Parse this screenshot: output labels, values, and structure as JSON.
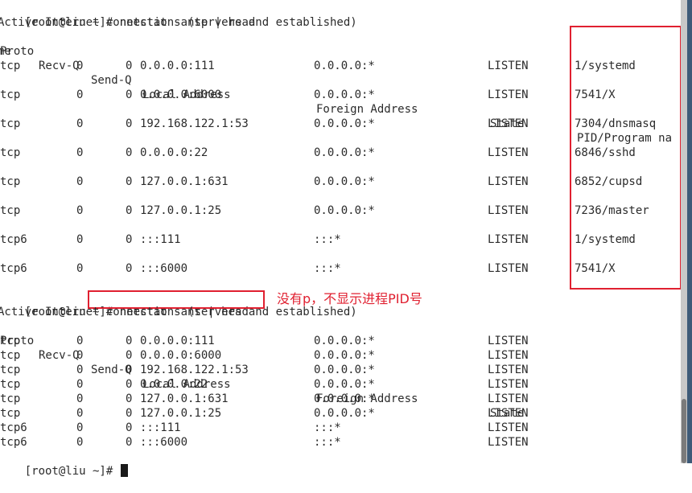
{
  "section1": {
    "prompt": "[root@liu ~]# ",
    "command": "netstat -antp | head",
    "info": "Active Internet connections (servers and established)",
    "headers": {
      "proto": "Proto",
      "recvq": "Recv-Q",
      "sendq": "Send-Q",
      "local": "Local Address",
      "foreign": "Foreign Address",
      "state": "State",
      "pid": "PID/Program na",
      "pid_wrap": "me"
    },
    "rows": [
      {
        "proto": "tcp",
        "recvq": "0",
        "sendq": "0",
        "local": "0.0.0.0:111",
        "foreign": "0.0.0.0:*",
        "state": "LISTEN",
        "pid": "1/systemd"
      },
      {
        "proto": "tcp",
        "recvq": "0",
        "sendq": "0",
        "local": "0.0.0.0:6000",
        "foreign": "0.0.0.0:*",
        "state": "LISTEN",
        "pid": "7541/X"
      },
      {
        "proto": "tcp",
        "recvq": "0",
        "sendq": "0",
        "local": "192.168.122.1:53",
        "foreign": "0.0.0.0:*",
        "state": "LISTEN",
        "pid": "7304/dnsmasq"
      },
      {
        "proto": "tcp",
        "recvq": "0",
        "sendq": "0",
        "local": "0.0.0.0:22",
        "foreign": "0.0.0.0:*",
        "state": "LISTEN",
        "pid": "6846/sshd"
      },
      {
        "proto": "tcp",
        "recvq": "0",
        "sendq": "0",
        "local": "127.0.0.1:631",
        "foreign": "0.0.0.0:*",
        "state": "LISTEN",
        "pid": "6852/cupsd"
      },
      {
        "proto": "tcp",
        "recvq": "0",
        "sendq": "0",
        "local": "127.0.0.1:25",
        "foreign": "0.0.0.0:*",
        "state": "LISTEN",
        "pid": "7236/master"
      },
      {
        "proto": "tcp6",
        "recvq": "0",
        "sendq": "0",
        "local": ":::111",
        "foreign": ":::*",
        "state": "LISTEN",
        "pid": "1/systemd"
      },
      {
        "proto": "tcp6",
        "recvq": "0",
        "sendq": "0",
        "local": ":::6000",
        "foreign": ":::*",
        "state": "LISTEN",
        "pid": "7541/X"
      }
    ]
  },
  "section2": {
    "prompt": "[root@liu ~]# ",
    "command": "netstat -ant | head",
    "annotation": "没有p，不显示进程PID号",
    "info": "Active Internet connections (servers and established)",
    "headers": {
      "proto": "Proto",
      "recvq": "Recv-Q",
      "sendq": "Send-Q",
      "local": "Local Address",
      "foreign": "Foreign Address",
      "state": "State"
    },
    "rows": [
      {
        "proto": "tcp",
        "recvq": "0",
        "sendq": "0",
        "local": "0.0.0.0:111",
        "foreign": "0.0.0.0:*",
        "state": "LISTEN"
      },
      {
        "proto": "tcp",
        "recvq": "0",
        "sendq": "0",
        "local": "0.0.0.0:6000",
        "foreign": "0.0.0.0:*",
        "state": "LISTEN"
      },
      {
        "proto": "tcp",
        "recvq": "0",
        "sendq": "0",
        "local": "192.168.122.1:53",
        "foreign": "0.0.0.0:*",
        "state": "LISTEN"
      },
      {
        "proto": "tcp",
        "recvq": "0",
        "sendq": "0",
        "local": "0.0.0.0:22",
        "foreign": "0.0.0.0:*",
        "state": "LISTEN"
      },
      {
        "proto": "tcp",
        "recvq": "0",
        "sendq": "0",
        "local": "127.0.0.1:631",
        "foreign": "0.0.0.0:*",
        "state": "LISTEN"
      },
      {
        "proto": "tcp",
        "recvq": "0",
        "sendq": "0",
        "local": "127.0.0.1:25",
        "foreign": "0.0.0.0:*",
        "state": "LISTEN"
      },
      {
        "proto": "tcp6",
        "recvq": "0",
        "sendq": "0",
        "local": ":::111",
        "foreign": ":::*",
        "state": "LISTEN"
      },
      {
        "proto": "tcp6",
        "recvq": "0",
        "sendq": "0",
        "local": ":::6000",
        "foreign": ":::*",
        "state": "LISTEN"
      }
    ]
  },
  "final_prompt": "[root@liu ~]# ",
  "colors": {
    "highlight": "#e02030",
    "text": "#2b2b2b",
    "background": "#ffffff"
  }
}
